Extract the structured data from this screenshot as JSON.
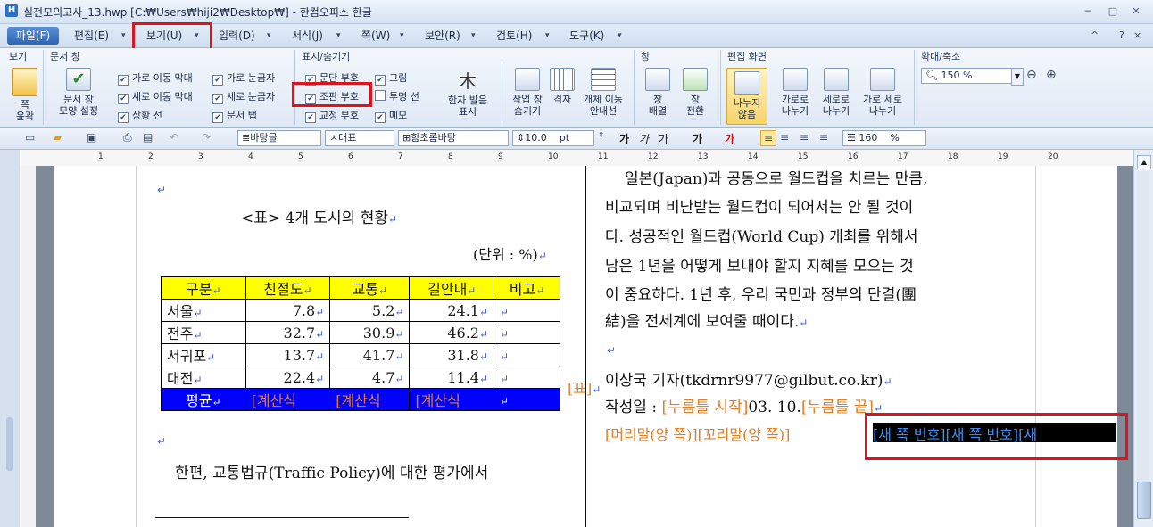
{
  "window": {
    "title": "실전모의고사_13.hwp [C:₩Users₩hiji2₩Desktop₩] - 한컴오피스 한글",
    "app_icon": "H",
    "minimize": "─",
    "maximize": "□",
    "close": "✕"
  },
  "menu": {
    "file": "파일(F)",
    "items": [
      "편집(E)",
      "보기(U)",
      "입력(D)",
      "서식(J)",
      "쪽(W)",
      "보안(R)",
      "검토(H)",
      "도구(K)"
    ],
    "help_icons": [
      "^",
      "?",
      "×"
    ]
  },
  "ribbon": {
    "groups": {
      "view": "보기",
      "doc_window": "문서 창",
      "show_hide": "표시/숨기기",
      "window": "창",
      "edit_screen": "편집 화면",
      "zoom": "확대/축소"
    },
    "big_buttons": {
      "page_outline": "쪽\n윤곽",
      "doc_window_mode": "문서 창\n모양 설정",
      "hanja_reading": "한자 발음\n표시",
      "work_window": "작업 창\n숨기기",
      "grid": "격자",
      "object_move_guide": "개체 이동\n안내선",
      "window_arrange": "창\n배열",
      "window_switch": "창\n전환",
      "no_split": "나누지\n않음",
      "split_horizontal": "가로로\n나누기",
      "split_vertical": "세로로\n나누기",
      "split_both": "가로 세로\n나누기"
    },
    "checkboxes_docwin": [
      {
        "label": "가로 이동 막대",
        "checked": true
      },
      {
        "label": "세로 이동 막대",
        "checked": true
      },
      {
        "label": "상황 선",
        "checked": true
      },
      {
        "label": "가로 눈금자",
        "checked": true
      },
      {
        "label": "세로 눈금자",
        "checked": true
      },
      {
        "label": "문서 탭",
        "checked": true
      }
    ],
    "checkboxes_show": [
      {
        "label": "문단 부호",
        "checked": true
      },
      {
        "label": "조판 부호",
        "checked": true
      },
      {
        "label": "교정 부호",
        "checked": true
      },
      {
        "label": "그림",
        "checked": true
      },
      {
        "label": "투명 선",
        "checked": false
      },
      {
        "label": "메모",
        "checked": true
      }
    ],
    "zoom_value": "150 %"
  },
  "toolbar": {
    "style": "바탕글",
    "font_lang": "대표",
    "font_name": "함초롬바탕",
    "font_size": "10.0",
    "font_unit": "pt",
    "line_spacing": "160",
    "line_unit": "%",
    "bold_label": "가",
    "italic_label": "가",
    "underline_label": "가",
    "char_label": "가",
    "color_label": "가"
  },
  "ruler": {
    "ticks": [
      "1",
      "2",
      "3",
      "4",
      "5",
      "6",
      "7",
      "8",
      "9",
      "10",
      "11",
      "12",
      "13",
      "14",
      "15",
      "16",
      "17",
      "18",
      "19",
      "20"
    ]
  },
  "doc": {
    "left": {
      "table_title": "<표> 4개 도시의 현황",
      "unit_note": "(단위 : %)",
      "table_header": [
        "구분",
        "친절도",
        "교통",
        "길안내",
        "비고"
      ],
      "table_rows": [
        [
          "서울",
          "7.8",
          "5.2",
          "24.1",
          ""
        ],
        [
          "전주",
          "32.7",
          "30.9",
          "46.2",
          ""
        ],
        [
          "서귀포",
          "13.7",
          "41.7",
          "31.8",
          ""
        ],
        [
          "대전",
          "22.4",
          "4.7",
          "11.4",
          ""
        ]
      ],
      "table_avg": [
        "평균",
        "[계산식",
        "[계산식",
        "[계산식",
        ""
      ],
      "table_code": "[표]",
      "paragraph": "한편, 교통법규(Traffic Policy)에 대한 평가에서"
    },
    "right": {
      "lines": [
        "일본(Japan)과 공동으로 월드컵을 치르는 만큼,",
        "비교되며 비난받는 월드컵이 되어서는 안 될 것이",
        "다. 성공적인 월드컵(World Cup) 개최를 위해서",
        "남은 1년을 어떻게 보내야 할지 지혜를 모으는 것",
        "이 중요하다. 1년 후, 우리 국민과 정부의 단결(團",
        "結)을 전세계에 보여줄 때이다."
      ],
      "reporter": "이상국 기자(tkdrnr9977@gilbut.co.kr)",
      "date_prefix": "작성일 : ",
      "field_start": "[누름틀 시작]",
      "date_value": "03. 10.",
      "field_end": "[누름틀 끝]",
      "header_code": "[머리말(양 쪽)]",
      "footer_code": "[꼬리말(양 쪽)]",
      "new_page_codes": "[새 쪽 번호][새 쪽 번호][새"
    }
  },
  "colors": {
    "highlight_red": "#e0121b",
    "header_yellow": "#ffff00",
    "avg_blue": "#0000ff",
    "code_orange": "#e67e22"
  }
}
